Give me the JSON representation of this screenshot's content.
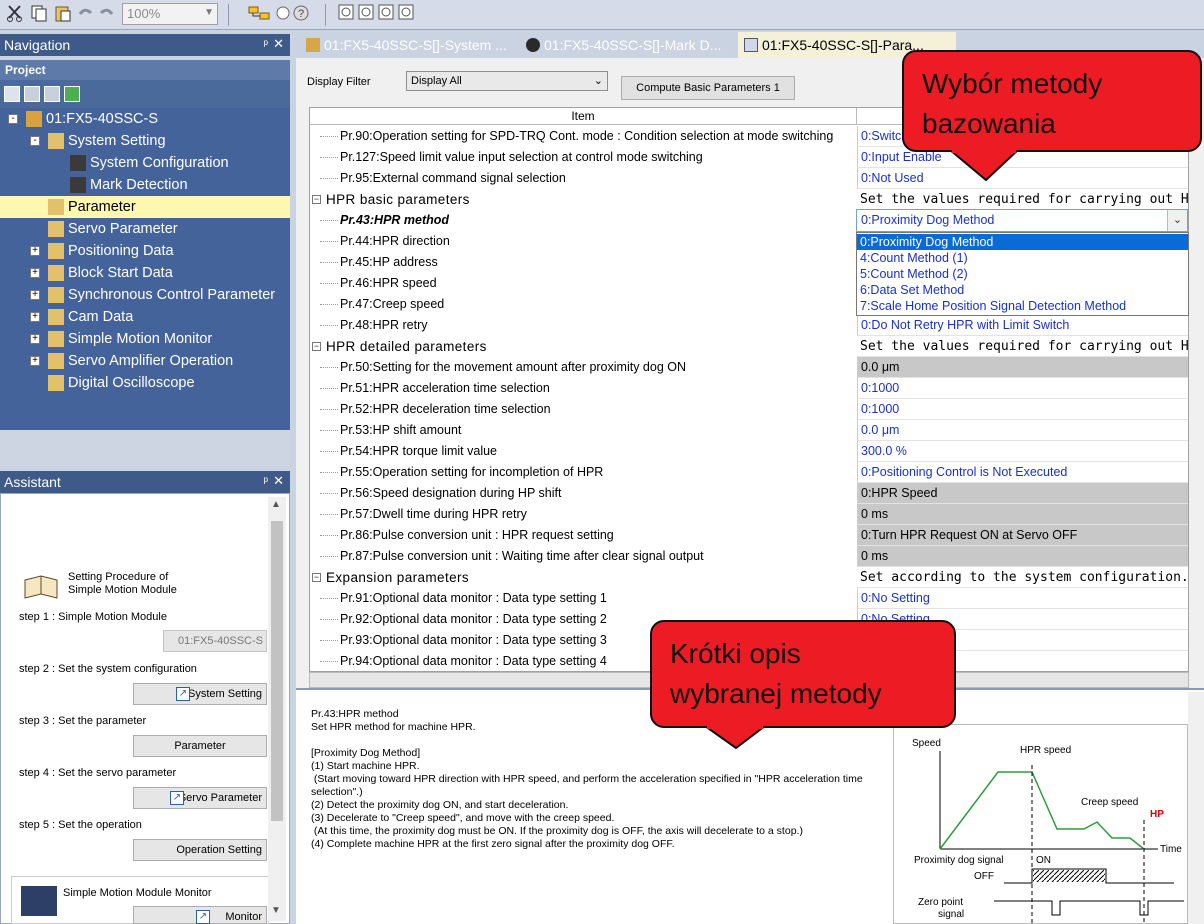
{
  "toolbar": {
    "zoom": "100%"
  },
  "navigation": {
    "title": "Navigation",
    "project_label": "Project",
    "tree": [
      {
        "label": "01:FX5-40SSC-S",
        "indent": 0,
        "expander": "-"
      },
      {
        "label": "System Setting",
        "indent": 1,
        "expander": "-"
      },
      {
        "label": "System Configuration",
        "indent": 2,
        "expander": ""
      },
      {
        "label": "Mark Detection",
        "indent": 2,
        "expander": ""
      },
      {
        "label": "Parameter",
        "indent": 1,
        "expander": "",
        "selected": true
      },
      {
        "label": "Servo Parameter",
        "indent": 1,
        "expander": ""
      },
      {
        "label": "Positioning Data",
        "indent": 1,
        "expander": "+"
      },
      {
        "label": "Block Start Data",
        "indent": 1,
        "expander": "+"
      },
      {
        "label": "Synchronous Control Parameter",
        "indent": 1,
        "expander": "+"
      },
      {
        "label": "Cam Data",
        "indent": 1,
        "expander": "+"
      },
      {
        "label": "Simple Motion Monitor",
        "indent": 1,
        "expander": "+"
      },
      {
        "label": "Servo Amplifier Operation",
        "indent": 1,
        "expander": "+"
      },
      {
        "label": "Digital Oscilloscope",
        "indent": 1,
        "expander": ""
      }
    ]
  },
  "assistant": {
    "title": "Assistant",
    "procedure_title_1": "Setting Procedure of",
    "procedure_title_2": "Simple Motion Module",
    "step1": "step 1 : Simple Motion Module",
    "step1_value": "01:FX5-40SSC-S",
    "step2": "step 2 : Set the system configuration",
    "step2_btn": "System Setting",
    "step3": "step 3 : Set the parameter",
    "step3_btn": "Parameter",
    "step4": "step 4 : Set the servo parameter",
    "step4_btn": "Servo Parameter",
    "step5": "step 5 : Set the operation",
    "step5_btn": "Operation Setting",
    "monitor_title": "Simple Motion Module Monitor",
    "monitor_btn": "Monitor"
  },
  "tabs": [
    {
      "label": "01:FX5-40SSC-S[]-System ..."
    },
    {
      "label": "01:FX5-40SSC-S[]-Mark D..."
    },
    {
      "label": "01:FX5-40SSC-S[]-Para..."
    }
  ],
  "main": {
    "filter_label": "Display Filter",
    "filter_value": "Display All",
    "compute_button": "Compute Basic Parameters 1",
    "column_item": "Item"
  },
  "rows": [
    {
      "item": "Pr.90:Operation setting for SPD-TRQ Cont. mode : Condition selection at mode switching",
      "value": "0:Switch"
    },
    {
      "item": "Pr.127:Speed limit value input selection at control mode switching",
      "value": "0:Input Enable"
    },
    {
      "item": "Pr.95:External command signal selection",
      "value": "0:Not Used"
    },
    {
      "item": "HPR basic parameters",
      "value": "Set the values required for carrying out H...",
      "group": true
    },
    {
      "item": "Pr.43:HPR method",
      "value": "",
      "bold": true
    },
    {
      "item": "Pr.44:HPR direction",
      "value": ""
    },
    {
      "item": "Pr.45:HP address",
      "value": ""
    },
    {
      "item": "Pr.46:HPR speed",
      "value": ""
    },
    {
      "item": "Pr.47:Creep speed",
      "value": ""
    },
    {
      "item": "Pr.48:HPR retry",
      "value": "0:Do Not Retry HPR with Limit Switch"
    },
    {
      "item": "HPR detailed parameters",
      "value": "Set the values required for carrying out H...",
      "group": true
    },
    {
      "item": "Pr.50:Setting for the movement amount after proximity dog ON",
      "value": "0.0 μm",
      "style": "gray"
    },
    {
      "item": "Pr.51:HPR acceleration time selection",
      "value": "0:1000"
    },
    {
      "item": "Pr.52:HPR deceleration time selection",
      "value": "0:1000"
    },
    {
      "item": "Pr.53:HP shift amount",
      "value": "0.0 μm"
    },
    {
      "item": "Pr.54:HPR torque limit value",
      "value": "300.0 %"
    },
    {
      "item": "Pr.55:Operation setting for incompletion of HPR",
      "value": "0:Positioning Control is Not Executed"
    },
    {
      "item": "Pr.56:Speed designation during HP shift",
      "value": "0:HPR Speed",
      "style": "gray"
    },
    {
      "item": "Pr.57:Dwell time during HPR retry",
      "value": "0 ms",
      "style": "gray"
    },
    {
      "item": "Pr.86:Pulse conversion unit : HPR request setting",
      "value": "0:Turn HPR Request ON at Servo OFF",
      "style": "gray"
    },
    {
      "item": "Pr.87:Pulse conversion unit : Waiting time after clear signal output",
      "value": "0 ms",
      "style": "gray"
    },
    {
      "item": "Expansion parameters",
      "value": "Set according to the system configuration...",
      "group": true
    },
    {
      "item": "Pr.91:Optional data monitor : Data type setting 1",
      "value": "0:No Setting"
    },
    {
      "item": "Pr.92:Optional data monitor : Data type setting 2",
      "value": "0:No Setting"
    },
    {
      "item": "Pr.93:Optional data monitor : Data type setting 3",
      "value": ""
    },
    {
      "item": "Pr.94:Optional data monitor : Data type setting 4",
      "value": ""
    }
  ],
  "combo": {
    "value": "0:Proximity Dog Method"
  },
  "dropdown_options": [
    {
      "label": "0:Proximity Dog Method",
      "selected": true
    },
    {
      "label": "4:Count Method (1)"
    },
    {
      "label": "5:Count Method (2)"
    },
    {
      "label": "6:Data Set Method"
    },
    {
      "label": "7:Scale Home Position Signal Detection Method"
    }
  ],
  "description": {
    "title": "Pr.43:HPR method",
    "text": "Set HPR method for machine HPR.\n\n[Proximity Dog Method]\n(1) Start machine HPR.\n (Start moving toward HPR direction with HPR speed, and perform the acceleration specified in \"HPR acceleration time selection\".)\n(2) Detect the proximity dog ON, and start deceleration.\n(3) Decelerate to \"Creep speed\", and move with the creep speed.\n (At this time, the proximity dog must be ON. If the proximity dog is OFF, the axis will decelerate to a stop.)\n(4) Complete machine HPR at the first zero signal after the proximity dog OFF."
  },
  "graph": {
    "speed": "Speed",
    "hpr_speed": "HPR speed",
    "creep_speed": "Creep speed",
    "hp": "HP",
    "time": "Time",
    "prox_signal": "Proximity dog signal",
    "on": "ON",
    "off": "OFF",
    "zero_1": "Zero point",
    "zero_2": "signal"
  },
  "callouts": {
    "top_1": "Wybór metody",
    "top_2": "bazowania",
    "bottom_1": "Krótki opis",
    "bottom_2": "wybranej metody"
  },
  "colors": {
    "accent": "#1a31c6",
    "callout": "#ec1b24",
    "nav": "#43639a"
  }
}
